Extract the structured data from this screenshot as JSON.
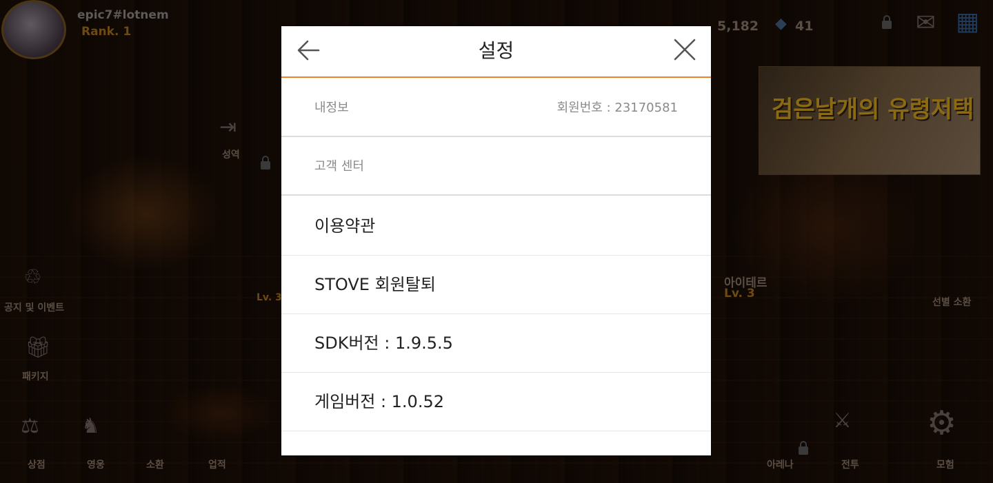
{
  "game": {
    "player_name": "epic7#lotnem",
    "rank": "Rank. 1",
    "currency_1": "5,182",
    "currency_2": "41",
    "left_labels": {
      "sanctuary": "성역",
      "notice": "공지 및 이벤트",
      "package": "패키지",
      "character_level": "Lv. 3"
    },
    "right_labels": {
      "aither": "아이테르",
      "aither_level": "Lv. 3",
      "summon": "선별 소환"
    },
    "bottom_menu": [
      "상점",
      "영웅",
      "소환",
      "업적",
      "아레나",
      "전투",
      "모험"
    ],
    "banner_text": "검은날개의 유령저택"
  },
  "modal": {
    "title": "설정",
    "rows": [
      {
        "label": "내정보",
        "value": "회원번호 : 23170581"
      },
      {
        "label": "고객 센터"
      },
      {
        "label": "이용약관"
      },
      {
        "label": "STOVE 회원탈퇴"
      },
      {
        "label": "SDK버전 : 1.9.5.5"
      },
      {
        "label": "게임버전 : 1.0.52"
      }
    ]
  },
  "colors": {
    "header_underline": "#f07f2a",
    "title_text": "#222222",
    "subtle_text": "#8a8a8a"
  }
}
